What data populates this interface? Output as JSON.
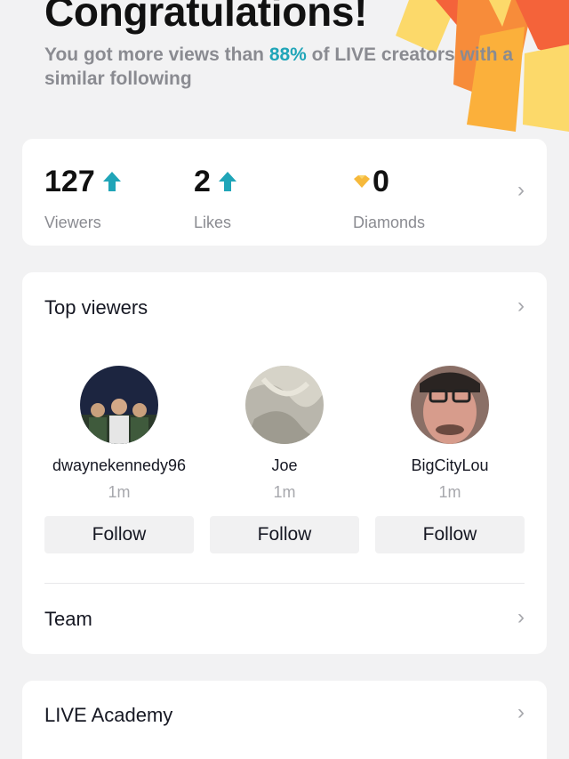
{
  "header": {
    "title": "Congratulations!",
    "subtitle_pre": "You got more views than ",
    "subtitle_highlight": "88%",
    "subtitle_post": " of LIVE creators with a similar following"
  },
  "stats": {
    "items": [
      {
        "value": "127",
        "label": "Viewers",
        "trend": "up",
        "icon": "arrow-up-icon"
      },
      {
        "value": "2",
        "label": "Likes",
        "trend": "up",
        "icon": "arrow-up-icon"
      },
      {
        "value": "0",
        "label": "Diamonds",
        "icon": "diamond-icon"
      }
    ]
  },
  "top_viewers": {
    "title": "Top viewers",
    "viewers": [
      {
        "name": "dwaynekennedy96",
        "time": "1m",
        "follow_label": "Follow"
      },
      {
        "name": "Joe",
        "time": "1m",
        "follow_label": "Follow"
      },
      {
        "name": "BigCityLou",
        "time": "1m",
        "follow_label": "Follow"
      }
    ]
  },
  "team": {
    "label": "Team"
  },
  "academy": {
    "label": "LIVE Academy"
  },
  "colors": {
    "accent": "#20a5b8",
    "confetti": [
      "#fbb03b",
      "#f78c3a",
      "#f4633a",
      "#fcd96a"
    ]
  }
}
